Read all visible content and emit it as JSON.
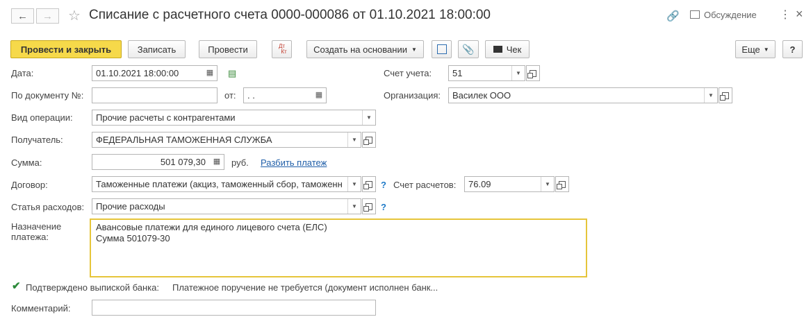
{
  "window": {
    "title": "Списание с расчетного счета 0000-000086 от 01.10.2021 18:00:00",
    "discussion_label": "Обсуждение",
    "more_icon": "vertical-dots-icon",
    "close_label": "×"
  },
  "nav": {
    "back_icon": "arrow-left-icon",
    "forward_icon": "arrow-right-icon",
    "star_icon": "star-icon"
  },
  "toolbar": {
    "post_close": "Провести и закрыть",
    "write": "Записать",
    "post": "Провести",
    "dtkt_top": "Дт",
    "dtkt_bottom": "Кт",
    "create_based": "Создать на основании",
    "receipt": "Чек",
    "more": "Еще",
    "help": "?"
  },
  "form": {
    "date_label": "Дата:",
    "date_value": "01.10.2021 18:00:00",
    "doc_label": "По документу №:",
    "doc_value": "",
    "from_label": "от:",
    "from_value": " .  .",
    "operation_label": "Вид операции:",
    "operation_value": "Прочие расчеты с контрагентами",
    "recipient_label": "Получатель:",
    "recipient_value": "ФЕДЕРАЛЬНАЯ ТАМОЖЕННАЯ СЛУЖБА",
    "sum_label": "Сумма:",
    "sum_value": "501 079,30",
    "currency": "руб.",
    "split_link": "Разбить платеж",
    "contract_label": "Договор:",
    "contract_value": "Таможенные платежи (акциз, таможенный сбор, таможенн",
    "expense_label": "Статья расходов:",
    "expense_value": "Прочие расходы",
    "account_label": "Счет учета:",
    "account_value": "51",
    "org_label": "Организация:",
    "org_value": "Василек ООО",
    "settle_label": "Счет расчетов:",
    "settle_value": "76.09",
    "purpose_label_1": "Назначение",
    "purpose_label_2": "платежа:",
    "purpose_line_1": "Авансовые платежи для единого лицевого счета (ЕЛС)",
    "purpose_line_2": "Сумма 501079-30",
    "confirmed_label": "Подтверждено выпиской банка:",
    "confirmed_checked": true,
    "payment_order_text": "Платежное поручение не требуется (документ исполнен банк...",
    "comment_label": "Комментарий:",
    "comment_value": "",
    "help_mark": "?"
  },
  "colors": {
    "primary_button": "#f6d94a",
    "link": "#1f5ea8",
    "focus_border": "#e6c53a",
    "help": "#1f7ac8"
  }
}
